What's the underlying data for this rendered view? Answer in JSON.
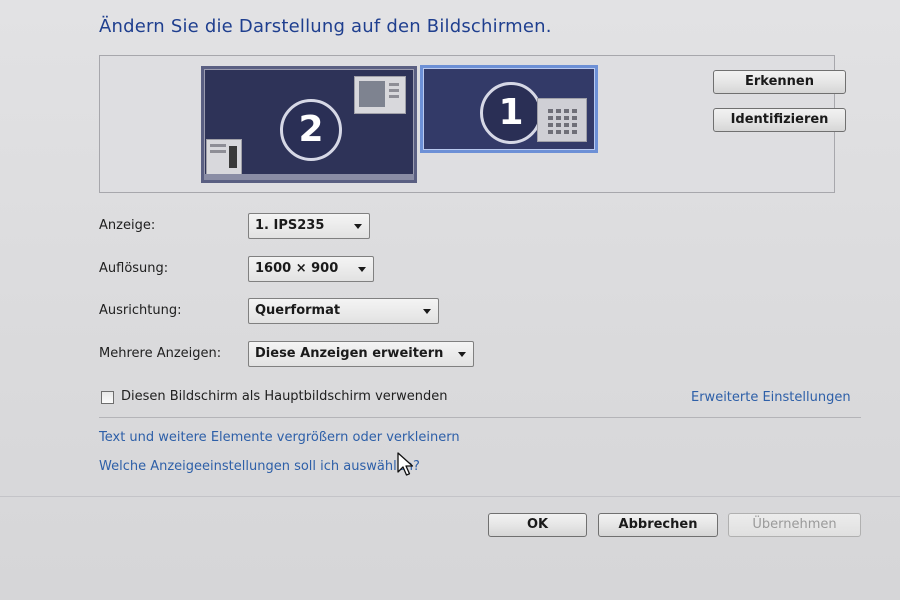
{
  "title": "Ändern Sie die Darstellung auf den Bildschirmen.",
  "monitors": [
    {
      "number": "2",
      "selected": false
    },
    {
      "number": "1",
      "selected": true
    }
  ],
  "buttons": {
    "erkennen": "Erkennen",
    "identifizieren": "Identifizieren",
    "ok": "OK",
    "abbrechen": "Abbrechen",
    "uebernehmen": "Übernehmen"
  },
  "settings": {
    "anzeige": {
      "label": "Anzeige:",
      "value": "1. IPS235"
    },
    "aufloesung": {
      "label": "Auflösung:",
      "value": "1600 × 900"
    },
    "ausrichtung": {
      "label": "Ausrichtung:",
      "value": "Querformat"
    },
    "mehrere": {
      "label": "Mehrere Anzeigen:",
      "value": "Diese Anzeigen erweitern"
    }
  },
  "checkbox": {
    "label": "Diesen Bildschirm als Hauptbildschirm verwenden",
    "checked": false
  },
  "links": {
    "erweitert": "Erweiterte Einstellungen",
    "text_groesse": "Text und weitere Elemente vergrößern oder verkleinern",
    "welche": "Welche Anzeigeeinstellungen soll ich auswählen?"
  },
  "colors": {
    "title": "#1f3f8f",
    "link": "#2d5fa8",
    "monitor": "#2e3358",
    "selected_border": "#6d90d6"
  },
  "icons": [
    "mouse-pointer-icon",
    "dropdown-arrow-icon"
  ]
}
